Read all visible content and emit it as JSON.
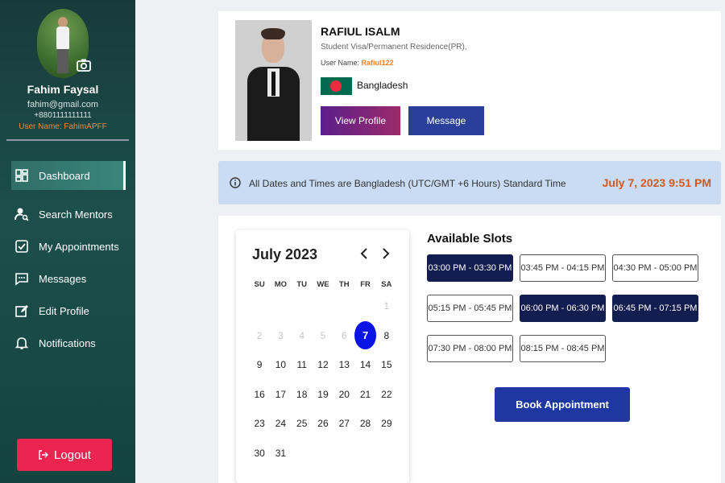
{
  "sidebar": {
    "user": {
      "name": "Fahim Faysal",
      "email": "fahim@gmail.com",
      "phone": "+8801111111111",
      "handle": "User Name: FahimAPFF"
    },
    "items": [
      {
        "label": "Dashboard",
        "icon": "dashboard-icon",
        "active": true
      },
      {
        "label": "Search Mentors",
        "icon": "search-user-icon"
      },
      {
        "label": "My Appointments",
        "icon": "checkbox-icon"
      },
      {
        "label": "Messages",
        "icon": "message-icon"
      },
      {
        "label": "Edit Profile",
        "icon": "edit-icon"
      },
      {
        "label": "Notifications",
        "icon": "bell-icon"
      }
    ],
    "logout_label": "Logout"
  },
  "profile": {
    "name": "RAFIUL ISALM",
    "visa": "Student Visa/Permanent Residence(PR),",
    "username_label": "User Name:",
    "username": "Rafiul122",
    "country": "Bangladesh",
    "view_profile_label": "View Profile",
    "message_label": "Message"
  },
  "banner": {
    "text": "All Dates and Times are Bangladesh (UTC/GMT +6 Hours) Standard Time",
    "datetime": "July 7, 2023 9:51 PM"
  },
  "calendar": {
    "title": "July 2023",
    "weekdays": [
      "SU",
      "MO",
      "TU",
      "WE",
      "TH",
      "FR",
      "SA"
    ],
    "weeks": [
      [
        "",
        "",
        "",
        "",
        "",
        "",
        "1"
      ],
      [
        "2",
        "3",
        "4",
        "5",
        "6",
        "7",
        "8"
      ],
      [
        "9",
        "10",
        "11",
        "12",
        "13",
        "14",
        "15"
      ],
      [
        "16",
        "17",
        "18",
        "19",
        "20",
        "21",
        "22"
      ],
      [
        "23",
        "24",
        "25",
        "26",
        "27",
        "28",
        "29"
      ],
      [
        "30",
        "31",
        "",
        "",
        "",
        "",
        ""
      ]
    ],
    "selected_day": "7"
  },
  "slots": {
    "title": "Available Slots",
    "items": [
      {
        "label": "03:00 PM - 03:30 PM",
        "selected": true
      },
      {
        "label": "03:45 PM - 04:15 PM",
        "selected": false
      },
      {
        "label": "04:30 PM - 05:00 PM",
        "selected": false
      },
      {
        "label": "05:15 PM - 05:45 PM",
        "selected": false
      },
      {
        "label": "06:00 PM - 06:30 PM",
        "selected": true
      },
      {
        "label": "06:45 PM - 07:15 PM",
        "selected": true
      },
      {
        "label": "07:30 PM - 08:00 PM",
        "selected": false
      },
      {
        "label": "08:15 PM - 08:45 PM",
        "selected": false
      }
    ],
    "book_label": "Book Appointment"
  },
  "colors": {
    "sidebar": "#1c4f4b",
    "accent_orange": "#d4581e",
    "primary_blue": "#1f37a0",
    "logout_red": "#ec2450",
    "selected_day": "#0b14e6"
  }
}
